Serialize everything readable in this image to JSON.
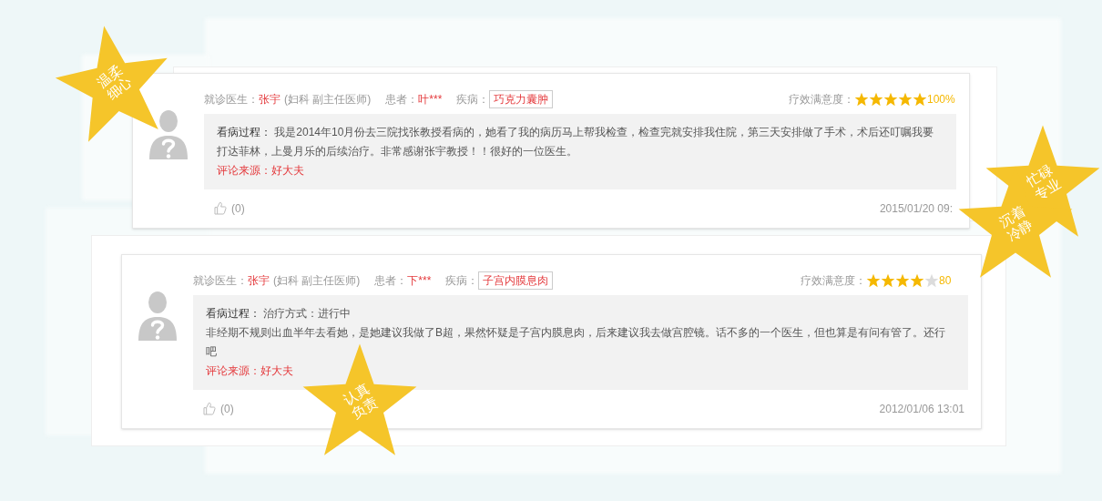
{
  "reviews": [
    {
      "doctor_label": "就诊医生：",
      "doctor": "张宇",
      "doctor_title": "(妇科 副主任医师)",
      "patient_label": "患者：",
      "patient": "叶***",
      "disease_label": "疾病：",
      "disease": "巧克力囊肿",
      "satisfaction_label": "疗效满意度：",
      "stars": 5,
      "percent": "100%",
      "process_label": "看病过程：",
      "process_intro": "我是2014年10月份去三院找张教授看病的，她看了我的病历马上帮我检查，检查完就安排我住院，第三天安排做了手术，术后还叮嘱我要打达菲林，上曼月乐的后续治疗。非常感谢张宇教授！！很好的一位医生。",
      "source": "评论来源：好大夫",
      "likes": "(0)",
      "date": "2015/01/20 09:"
    },
    {
      "doctor_label": "就诊医生：",
      "doctor": "张宇",
      "doctor_title": "(妇科 副主任医师)",
      "patient_label": "患者：",
      "patient": "下***",
      "disease_label": "疾病：",
      "disease": "子宫内膜息肉",
      "satisfaction_label": "疗效满意度：",
      "stars": 4,
      "percent": "80",
      "process_label": "看病过程：",
      "process_intro": "治疗方式：进行中",
      "body": "非经期不规则出血半年去看她，是她建议我做了B超，果然怀疑是子宫内膜息肉，后来建议我去做宫腔镜。话不多的一个医生，但也算是有问有管了。还行吧",
      "source": "评论来源：好大夫",
      "likes": "(0)",
      "date": "2012/01/06 13:01"
    }
  ],
  "badges": [
    {
      "text": "温柔细心"
    },
    {
      "text": "忙碌专业"
    },
    {
      "text": "沉着冷静"
    },
    {
      "text": "认真负责"
    }
  ]
}
